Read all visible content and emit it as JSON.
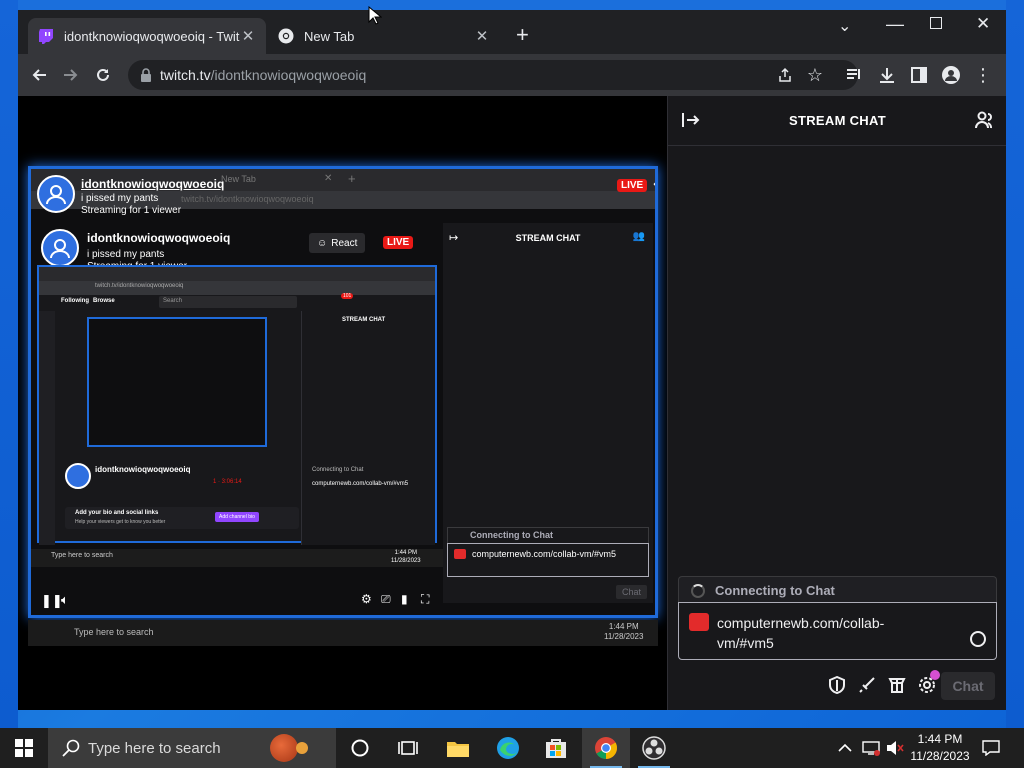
{
  "browser": {
    "tabs": [
      {
        "title": "idontknowioqwoqwoeoiq - Twitch",
        "active": true,
        "favicon": "twitch-icon"
      },
      {
        "title": "New Tab",
        "active": false,
        "favicon": "chrome-icon"
      }
    ],
    "new_tab_symbol": "+",
    "url_host": "twitch.tv",
    "url_path": "/idontknowioqwoqwoeoiq"
  },
  "stream": {
    "streamer": "idontknowioqwoqwoeoiq",
    "title": "i pissed my pants",
    "viewers": "Streaming for 1 viewer",
    "live_label": "LIVE",
    "react_label": "React"
  },
  "chat": {
    "header_title": "STREAM CHAT",
    "status": "Connecting to Chat",
    "input_text": "computernewb.com/collab-vm/#vm5",
    "send_label": "Chat"
  },
  "nested": {
    "tab_title": "New Tab",
    "url": "twitch.tv/idontknowioqwoqwoeoiq",
    "nav_following": "Following",
    "nav_browse": "Browse",
    "search_placeholder": "Search",
    "notif_count": "101",
    "bio_prompt": "Add your bio and social links",
    "bio_sub": "Help your viewers get to know you better",
    "add_bio_btn": "Add channel bio",
    "mini_time": "1:44 PM",
    "mini_date": "11/28/2023",
    "mini_search": "Type here to search",
    "mini_stats": "1 · 3:06:14"
  },
  "taskbar": {
    "search_placeholder": "Type here to search",
    "time": "1:44 PM",
    "date": "11/28/2023"
  },
  "colors": {
    "twitch_purple": "#9146ff",
    "live_red": "#e91916",
    "chrome_dark": "#202124",
    "toolbar": "#35363a",
    "chat_bg": "#18181b",
    "desktop_blue": "#0d63d6"
  }
}
